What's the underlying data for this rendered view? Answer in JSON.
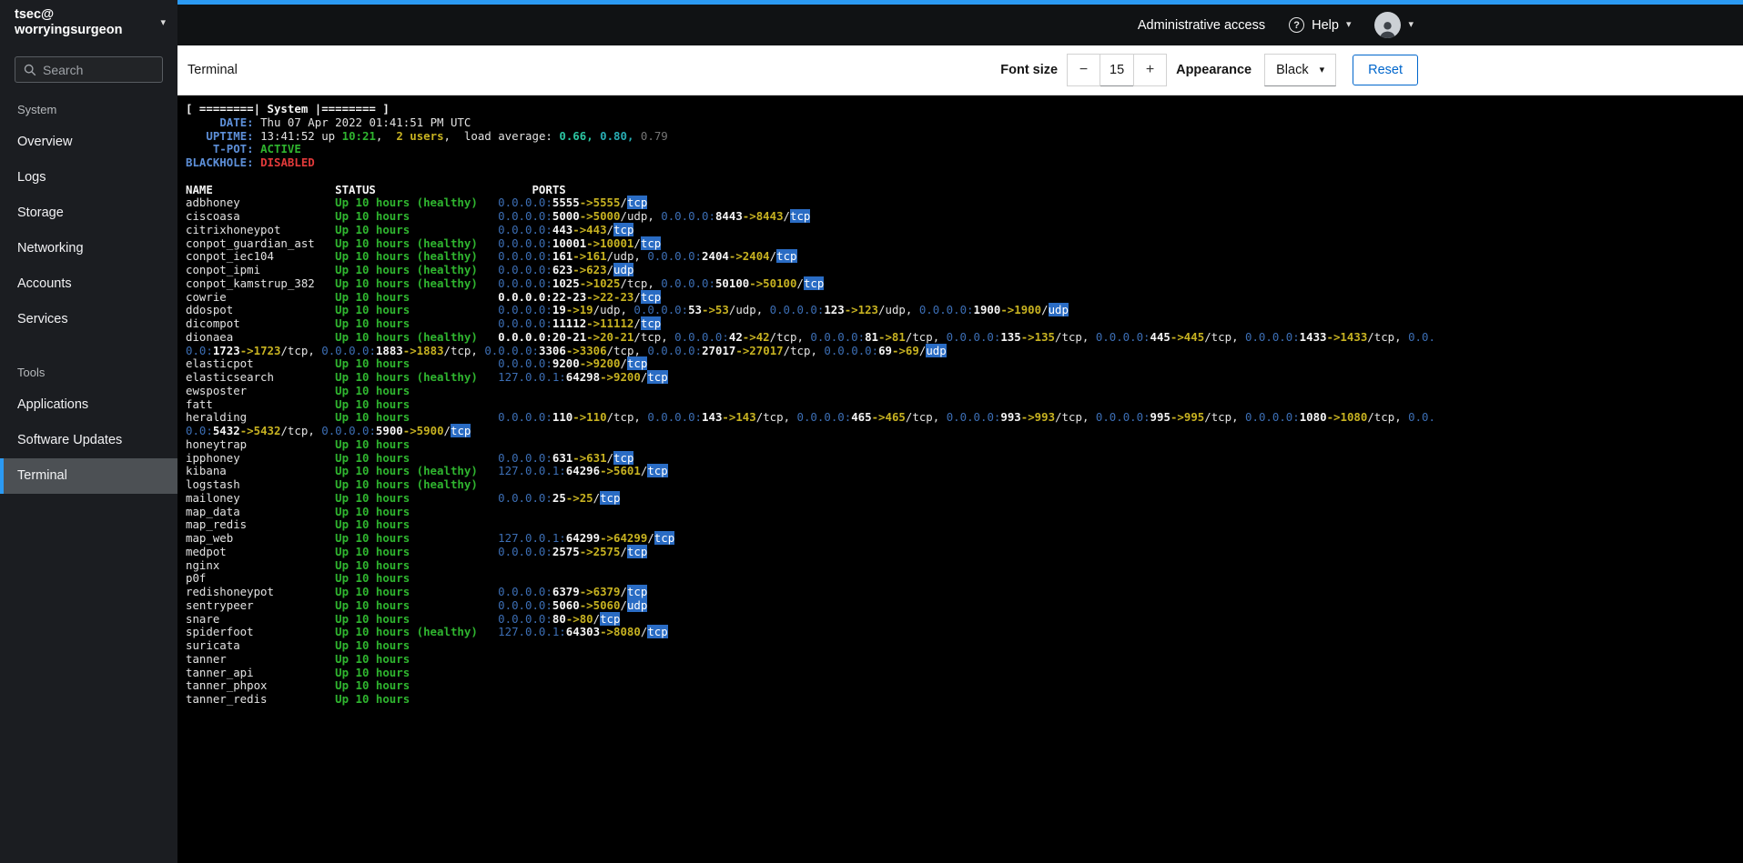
{
  "icons": {
    "caret_down": "▾",
    "question": "?"
  },
  "colors": {
    "ui": {
      "accent": "#2b9af3",
      "masthead_bg": "#101214",
      "sidebar_bg": "#1b1d21",
      "sidebar_active_bg": "#4c5054",
      "link_blue": "#0066cc",
      "toolbar_border": "#d2d2d2"
    },
    "terminal": {
      "fg": "#e2e2e2",
      "fg_bright": "#f5f5f5",
      "label_blue": "#5d8fd8",
      "ip_blue": "#3c6eb4",
      "green": "#2fb52f",
      "yellow": "#c7b221",
      "red": "#e23a3a",
      "teal": "#2cc5a2",
      "cyan": "#28adb4",
      "gray": "#757575",
      "highlight_bg": "#2a6cc4",
      "highlight_fg": "#ffffff"
    }
  },
  "masthead": {
    "user_line1": "tsec@",
    "user_line2": "worryingsurgeon",
    "admin_access_label": "Administrative access",
    "help_label": "Help"
  },
  "sidebar": {
    "search_placeholder": "Search",
    "sections": [
      {
        "label": "System",
        "items": [
          {
            "label": "Overview"
          },
          {
            "label": "Logs"
          },
          {
            "label": "Storage"
          },
          {
            "label": "Networking"
          },
          {
            "label": "Accounts"
          },
          {
            "label": "Services"
          }
        ]
      },
      {
        "label": "Tools",
        "items": [
          {
            "label": "Applications"
          },
          {
            "label": "Software Updates"
          },
          {
            "label": "Terminal",
            "active": true
          }
        ]
      }
    ]
  },
  "toolbar": {
    "title": "Terminal",
    "font_size_label": "Font size",
    "font_size_value": "15",
    "decrease_label": "−",
    "increase_label": "+",
    "appearance_label": "Appearance",
    "appearance_value": "Black",
    "reset_label": "Reset"
  },
  "terminal": {
    "banner": "[ ========| System |======== ]",
    "info": [
      {
        "label": "DATE:",
        "segments": [
          {
            "text": "Thu 07 Apr 2022 01:41:51 PM UTC",
            "color": "fg"
          }
        ]
      },
      {
        "label": "UPTIME:",
        "segments": [
          {
            "text": "13:41:52 up ",
            "color": "fg"
          },
          {
            "text": "10:21",
            "color": "green"
          },
          {
            "text": ",  ",
            "color": "fg"
          },
          {
            "text": "2 users",
            "color": "yellow"
          },
          {
            "text": ",  load average: ",
            "color": "fg"
          },
          {
            "text": "0.66,",
            "color": "teal"
          },
          {
            "text": " ",
            "color": "fg"
          },
          {
            "text": "0.80,",
            "color": "cyan"
          },
          {
            "text": " ",
            "color": "fg"
          },
          {
            "text": "0.79",
            "color": "gray"
          }
        ]
      },
      {
        "label": "T-POT:",
        "segments": [
          {
            "text": "ACTIVE",
            "color": "green"
          }
        ]
      },
      {
        "label": "BLACKHOLE:",
        "segments": [
          {
            "text": "DISABLED",
            "color": "red"
          }
        ]
      }
    ],
    "table": {
      "headers": [
        "NAME",
        "STATUS",
        "PORTS"
      ],
      "rows": [
        {
          "name": "adbhoney",
          "status": "Up 10 hours (healthy)",
          "ports": [
            "0.0.0.0:5555->5555/tcp"
          ]
        },
        {
          "name": "ciscoasa",
          "status": "Up 10 hours",
          "ports": [
            "0.0.0.0:5000->5000/udp",
            "0.0.0.0:8443->8443/tcp"
          ]
        },
        {
          "name": "citrixhoneypot",
          "status": "Up 10 hours",
          "ports": [
            "0.0.0.0:443->443/tcp"
          ]
        },
        {
          "name": "conpot_guardian_ast",
          "status": "Up 10 hours (healthy)",
          "ports": [
            "0.0.0.0:10001->10001/tcp"
          ]
        },
        {
          "name": "conpot_iec104",
          "status": "Up 10 hours (healthy)",
          "ports": [
            "0.0.0.0:161->161/udp",
            "0.0.0.0:2404->2404/tcp"
          ]
        },
        {
          "name": "conpot_ipmi",
          "status": "Up 10 hours (healthy)",
          "ports": [
            "0.0.0.0:623->623/udp"
          ]
        },
        {
          "name": "conpot_kamstrup_382",
          "status": "Up 10 hours (healthy)",
          "ports": [
            "0.0.0.0:1025->1025/tcp",
            "0.0.0.0:50100->50100/tcp"
          ]
        },
        {
          "name": "cowrie",
          "status": "Up 10 hours",
          "ports": [
            "0.0.0.0:22-23->22-23/tcp"
          ]
        },
        {
          "name": "ddospot",
          "status": "Up 10 hours",
          "ports": [
            "0.0.0.0:19->19/udp",
            "0.0.0.0:53->53/udp",
            "0.0.0.0:123->123/udp",
            "0.0.0.0:1900->1900/udp"
          ]
        },
        {
          "name": "dicompot",
          "status": "Up 10 hours",
          "ports": [
            "0.0.0.0:11112->11112/tcp"
          ]
        },
        {
          "name": "dionaea",
          "status": "Up 10 hours (healthy)",
          "ports": [
            "0.0.0.0:20-21->20-21/tcp",
            "0.0.0.0:42->42/tcp",
            "0.0.0.0:81->81/tcp",
            "0.0.0.0:135->135/tcp",
            "0.0.0.0:445->445/tcp",
            "0.0.0.0:1433->1433/tcp",
            "0.0.0.0:1723->1723/tcp",
            "0.0.0.0:1883->1883/tcp",
            "0.0.0.0:3306->3306/tcp",
            "0.0.0.0:27017->27017/tcp",
            "0.0.0.0:69->69/udp"
          ]
        },
        {
          "name": "elasticpot",
          "status": "Up 10 hours",
          "ports": [
            "0.0.0.0:9200->9200/tcp"
          ]
        },
        {
          "name": "elasticsearch",
          "status": "Up 10 hours (healthy)",
          "ports": [
            "127.0.0.1:64298->9200/tcp"
          ]
        },
        {
          "name": "ewsposter",
          "status": "Up 10 hours",
          "ports": []
        },
        {
          "name": "fatt",
          "status": "Up 10 hours",
          "ports": []
        },
        {
          "name": "heralding",
          "status": "Up 10 hours",
          "ports": [
            "0.0.0.0:110->110/tcp",
            "0.0.0.0:143->143/tcp",
            "0.0.0.0:465->465/tcp",
            "0.0.0.0:993->993/tcp",
            "0.0.0.0:995->995/tcp",
            "0.0.0.0:1080->1080/tcp",
            "0.0.0.0:5432->5432/tcp",
            "0.0.0.0:5900->5900/tcp"
          ]
        },
        {
          "name": "honeytrap",
          "status": "Up 10 hours",
          "ports": []
        },
        {
          "name": "ipphoney",
          "status": "Up 10 hours",
          "ports": [
            "0.0.0.0:631->631/tcp"
          ]
        },
        {
          "name": "kibana",
          "status": "Up 10 hours (healthy)",
          "ports": [
            "127.0.0.1:64296->5601/tcp"
          ]
        },
        {
          "name": "logstash",
          "status": "Up 10 hours (healthy)",
          "ports": []
        },
        {
          "name": "mailoney",
          "status": "Up 10 hours",
          "ports": [
            "0.0.0.0:25->25/tcp"
          ]
        },
        {
          "name": "map_data",
          "status": "Up 10 hours",
          "ports": []
        },
        {
          "name": "map_redis",
          "status": "Up 10 hours",
          "ports": []
        },
        {
          "name": "map_web",
          "status": "Up 10 hours",
          "ports": [
            "127.0.0.1:64299->64299/tcp"
          ]
        },
        {
          "name": "medpot",
          "status": "Up 10 hours",
          "ports": [
            "0.0.0.0:2575->2575/tcp"
          ]
        },
        {
          "name": "nginx",
          "status": "Up 10 hours",
          "ports": []
        },
        {
          "name": "p0f",
          "status": "Up 10 hours",
          "ports": []
        },
        {
          "name": "redishoneypot",
          "status": "Up 10 hours",
          "ports": [
            "0.0.0.0:6379->6379/tcp"
          ]
        },
        {
          "name": "sentrypeer",
          "status": "Up 10 hours",
          "ports": [
            "0.0.0.0:5060->5060/udp"
          ]
        },
        {
          "name": "snare",
          "status": "Up 10 hours",
          "ports": [
            "0.0.0.0:80->80/tcp"
          ]
        },
        {
          "name": "spiderfoot",
          "status": "Up 10 hours (healthy)",
          "ports": [
            "127.0.0.1:64303->8080/tcp"
          ]
        },
        {
          "name": "suricata",
          "status": "Up 10 hours",
          "ports": []
        },
        {
          "name": "tanner",
          "status": "Up 10 hours",
          "ports": []
        },
        {
          "name": "tanner_api",
          "status": "Up 10 hours",
          "ports": []
        },
        {
          "name": "tanner_phpox",
          "status": "Up 10 hours",
          "ports": []
        },
        {
          "name": "tanner_redis",
          "status": "Up 10 hours",
          "ports": []
        }
      ]
    }
  }
}
